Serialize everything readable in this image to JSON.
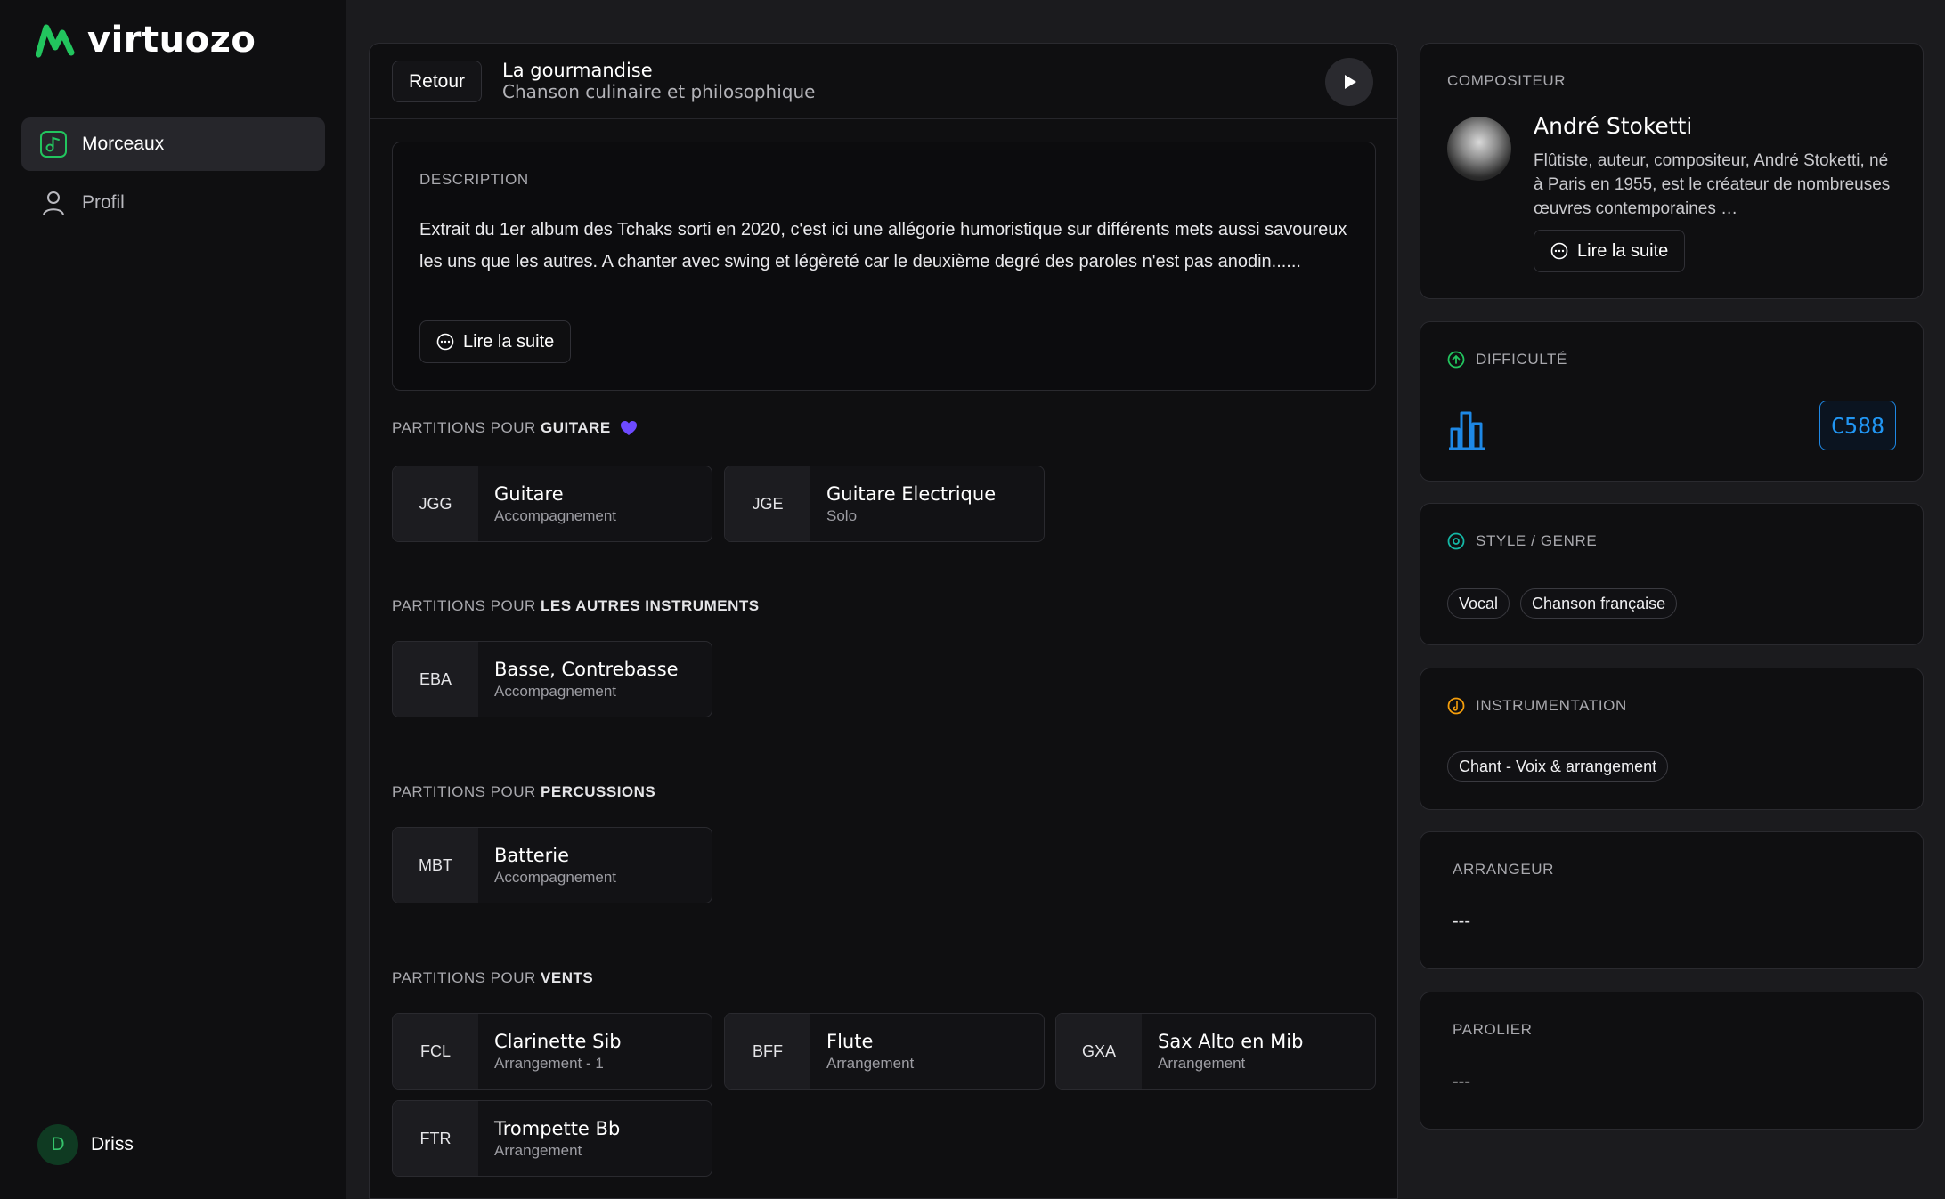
{
  "app": {
    "name": "virtuozo",
    "brand_color": "#22c55e"
  },
  "sidebar": {
    "items": [
      {
        "label": "Morceaux",
        "icon": "music-note-icon",
        "active": true
      },
      {
        "label": "Profil",
        "icon": "user-icon",
        "active": false
      }
    ],
    "user": {
      "initial": "D",
      "name": "Driss"
    }
  },
  "header": {
    "back_label": "Retour",
    "title": "La gourmandise",
    "subtitle": "Chanson culinaire et philosophique",
    "play_icon": "play-icon"
  },
  "description": {
    "label": "DESCRIPTION",
    "text": "Extrait du 1er album des Tchaks sorti en 2020, c'est ici une allégorie humoristique sur différents mets aussi savoureux les uns que les autres. A chanter avec swing et légèreté car le deuxième degré des paroles n'est pas anodin......",
    "read_more": "Lire la suite"
  },
  "sections": [
    {
      "prefix": "PARTITIONS POUR ",
      "instrument": "GUITARE",
      "favorite": true,
      "parts": [
        {
          "code": "JGG",
          "name": "Guitare",
          "sub": "Accompagnement"
        },
        {
          "code": "JGE",
          "name": "Guitare Electrique",
          "sub": "Solo"
        }
      ]
    },
    {
      "prefix": "PARTITIONS POUR ",
      "instrument": "LES AUTRES INSTRUMENTS",
      "parts": [
        {
          "code": "EBA",
          "name": "Basse, Contrebasse",
          "sub": "Accompagnement"
        }
      ]
    },
    {
      "prefix": "PARTITIONS POUR ",
      "instrument": "PERCUSSIONS",
      "parts": [
        {
          "code": "MBT",
          "name": "Batterie",
          "sub": "Accompagnement"
        }
      ]
    },
    {
      "prefix": "PARTITIONS POUR ",
      "instrument": "VENTS",
      "parts": [
        {
          "code": "FCL",
          "name": "Clarinette Sib",
          "sub": "Arrangement - 1"
        },
        {
          "code": "BFF",
          "name": "Flute",
          "sub": "Arrangement"
        },
        {
          "code": "GXA",
          "name": "Sax Alto en Mib",
          "sub": "Arrangement"
        },
        {
          "code": "FTR",
          "name": "Trompette Bb",
          "sub": "Arrangement"
        }
      ]
    }
  ],
  "composer": {
    "label": "COMPOSITEUR",
    "name": "André Stoketti",
    "bio": "Flûtiste, auteur, compositeur, André Stoketti, né à Paris en 1955, est le créateur de nombreuses œuvres contemporaines …",
    "read_more": "Lire la suite"
  },
  "difficulty": {
    "label": "DIFFICULTÉ",
    "level": "C588",
    "accent": "#2196f3"
  },
  "style": {
    "label": "STYLE / GENRE",
    "tags": [
      "Vocal",
      "Chanson française"
    ]
  },
  "instrumentation": {
    "label": "INSTRUMENTATION",
    "tags": [
      "Chant - Voix & arrangement"
    ]
  },
  "arranger": {
    "label": "ARRANGEUR",
    "value": "---"
  },
  "lyricist": {
    "label": "PAROLIER",
    "value": "---"
  }
}
